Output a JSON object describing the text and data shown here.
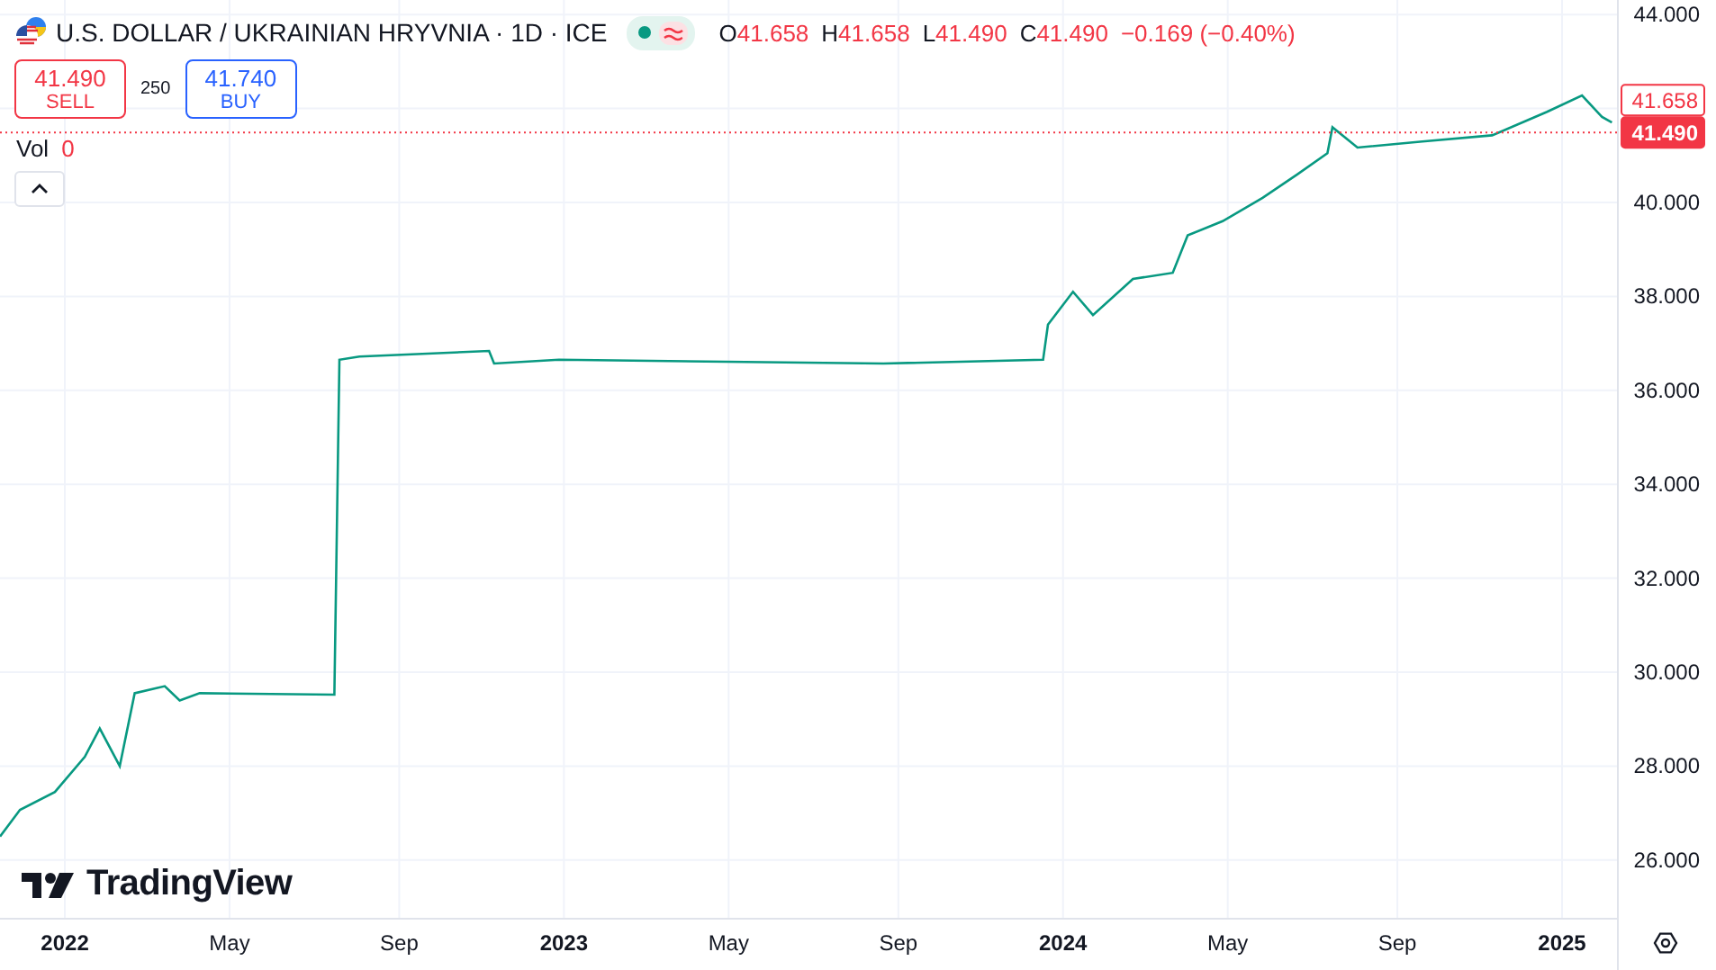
{
  "legend": {
    "symbol": "U.S. DOLLAR / UKRAINIAN HRYVNIA · 1D · ICE",
    "ohlc": [
      {
        "prefix": "O",
        "value": "41.658"
      },
      {
        "prefix": "H",
        "value": "41.658"
      },
      {
        "prefix": "L",
        "value": "41.490"
      },
      {
        "prefix": "C",
        "value": "41.490"
      }
    ],
    "change": "−0.169 (−0.40%)"
  },
  "trade": {
    "sell": {
      "price": "41.490",
      "label": "SELL"
    },
    "spread": "250",
    "buy": {
      "price": "41.740",
      "label": "BUY"
    }
  },
  "volume": {
    "label": "Vol",
    "value": "0"
  },
  "logo": "TradingView",
  "chart_data": {
    "type": "line",
    "xlim": [
      2021.87,
      2025.11
    ],
    "ylim": [
      24.77,
      44.31
    ],
    "x": [
      2021.87,
      2021.91,
      2021.98,
      2022.04,
      2022.07,
      2022.11,
      2022.14,
      2022.2,
      2022.23,
      2022.27,
      2022.54,
      2022.55,
      2022.59,
      2022.85,
      2022.86,
      2022.99,
      2023.64,
      2023.96,
      2023.97,
      2024.02,
      2024.06,
      2024.14,
      2024.22,
      2024.25,
      2024.32,
      2024.4,
      2024.47,
      2024.53,
      2024.54,
      2024.59,
      2024.72,
      2024.86,
      2024.97,
      2025.04,
      2025.08,
      2025.1
    ],
    "series": [
      {
        "color": "#089981",
        "values": [
          26.5,
          27.07,
          27.45,
          28.2,
          28.8,
          28.0,
          29.55,
          29.7,
          29.4,
          29.55,
          29.52,
          36.65,
          36.72,
          36.84,
          36.57,
          36.65,
          36.57,
          36.65,
          37.4,
          38.1,
          37.6,
          38.37,
          38.5,
          39.3,
          39.6,
          40.1,
          40.6,
          41.05,
          41.6,
          41.17,
          41.3,
          41.43,
          41.93,
          42.28,
          41.82,
          41.7
        ]
      }
    ],
    "xticks": [
      {
        "value": 2022,
        "label": "2022"
      },
      {
        "value": 2022.33,
        "label": "May"
      },
      {
        "value": 2022.67,
        "label": "Sep"
      },
      {
        "value": 2023,
        "label": "2023"
      },
      {
        "value": 2023.33,
        "label": "May"
      },
      {
        "value": 2023.67,
        "label": "Sep"
      },
      {
        "value": 2024,
        "label": "2024"
      },
      {
        "value": 2024.33,
        "label": "May"
      },
      {
        "value": 2024.67,
        "label": "Sep"
      },
      {
        "value": 2025,
        "label": "2025"
      }
    ],
    "yticks": [
      {
        "value": 26,
        "label": "26.000"
      },
      {
        "value": 28,
        "label": "28.000"
      },
      {
        "value": 30,
        "label": "30.000"
      },
      {
        "value": 32,
        "label": "32.000"
      },
      {
        "value": 34,
        "label": "34.000"
      },
      {
        "value": 36,
        "label": "36.000"
      },
      {
        "value": 38,
        "label": "38.000"
      },
      {
        "value": 40,
        "label": "40.000"
      },
      {
        "value": 44,
        "label": "44.000"
      }
    ],
    "grid": true,
    "ref_lines": [
      {
        "axis": "y",
        "value": 41.49,
        "label": "41.490",
        "color": "#f23645"
      }
    ],
    "annotations": [
      "41.658"
    ]
  }
}
